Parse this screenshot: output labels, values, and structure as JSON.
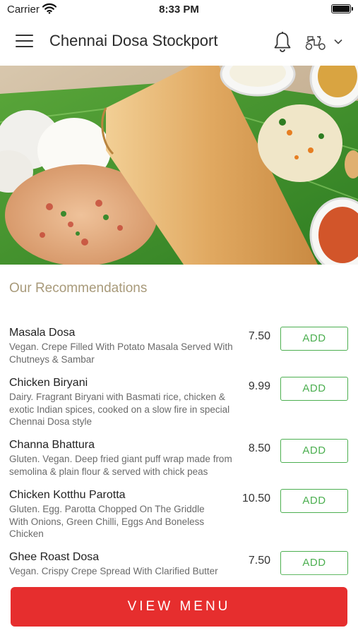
{
  "status_bar": {
    "carrier": "Carrier",
    "time": "8:33 PM"
  },
  "header": {
    "title": "Chennai Dosa Stockport"
  },
  "icons": {
    "menu": "hamburger-menu-icon",
    "notifications": "bell-icon",
    "order_mode": "scooter-icon",
    "dropdown": "chevron-down-icon"
  },
  "recommendations": {
    "title": "Our Recommendations",
    "add_label": "ADD",
    "items": [
      {
        "name": "Masala Dosa",
        "description": "Vegan. Crepe Filled With Potato Masala Served With Chutneys & Sambar",
        "price": "7.50"
      },
      {
        "name": "Chicken Biryani",
        "description": "Dairy. Fragrant Biryani with Basmati rice, chicken & exotic Indian spices, cooked on a slow fire in special Chennai Dosa style",
        "price": "9.99"
      },
      {
        "name": "Channa Bhattura",
        "description": "Gluten. Vegan. Deep fried giant puff wrap made from semolina & plain flour & served with chick peas",
        "price": "8.50"
      },
      {
        "name": "Chicken Kotthu Parotta",
        "description": "Gluten. Egg. Parotta Chopped On The Griddle With Onions, Green Chilli, Eggs And Boneless Chicken",
        "price": "10.50"
      },
      {
        "name": "Ghee Roast Dosa",
        "description": "Vegan. Crispy Crepe Spread With Clarified Butter",
        "price": "7.50"
      }
    ]
  },
  "view_menu_label": "VIEW MENU",
  "colors": {
    "accent_green": "#4caf50",
    "cta_red": "#e62e2e",
    "section_title": "#a89a7a"
  }
}
